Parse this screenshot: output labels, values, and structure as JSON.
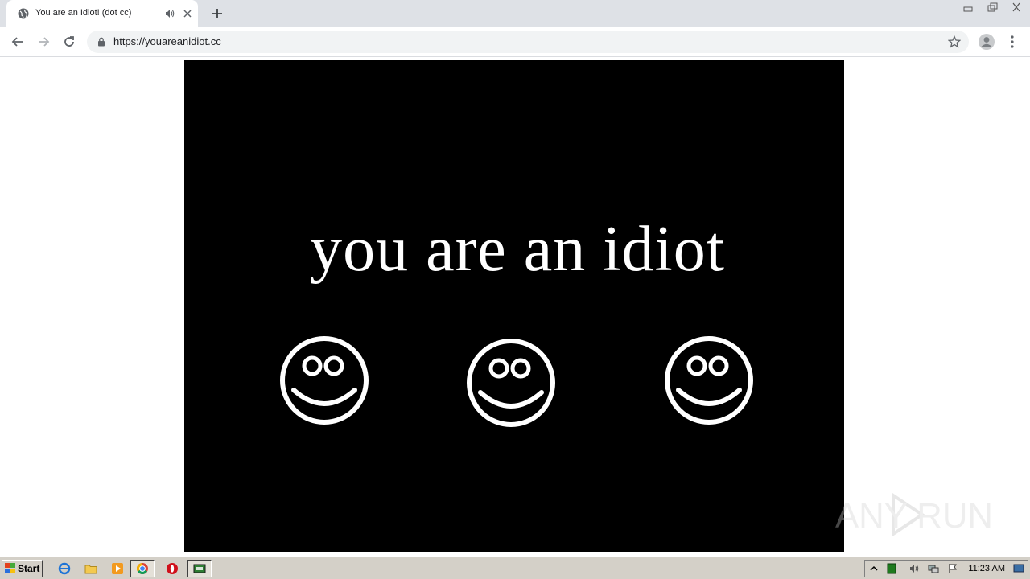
{
  "browser": {
    "tab": {
      "title": "You are an Idiot! (dot cc)",
      "favicon": "globe-icon",
      "audio": "speaker-icon",
      "close": "close-icon"
    },
    "new_tab": "plus-icon",
    "address": {
      "url": "https://youareanidiot.cc",
      "secure_icon": "lock-icon"
    },
    "icons": [
      "back-arrow-icon",
      "forward-arrow-icon",
      "reload-icon",
      "star-icon",
      "profile-icon",
      "kebab-menu-icon"
    ],
    "window_controls": [
      "minimize-icon",
      "restore-icon",
      "close-icon"
    ]
  },
  "page": {
    "headline": "you are an idiot",
    "smileys": [
      "smiley-face-icon",
      "smiley-face-icon",
      "smiley-face-icon"
    ],
    "background": "#000000",
    "foreground": "#ffffff"
  },
  "watermark": {
    "text": "ANY RUN"
  },
  "taskbar": {
    "start_label": "Start",
    "quick_launch": [
      "internet-explorer-icon",
      "folder-icon",
      "media-player-icon",
      "chrome-icon",
      "opera-icon",
      "network-icon"
    ],
    "clock": "11:23 AM"
  }
}
